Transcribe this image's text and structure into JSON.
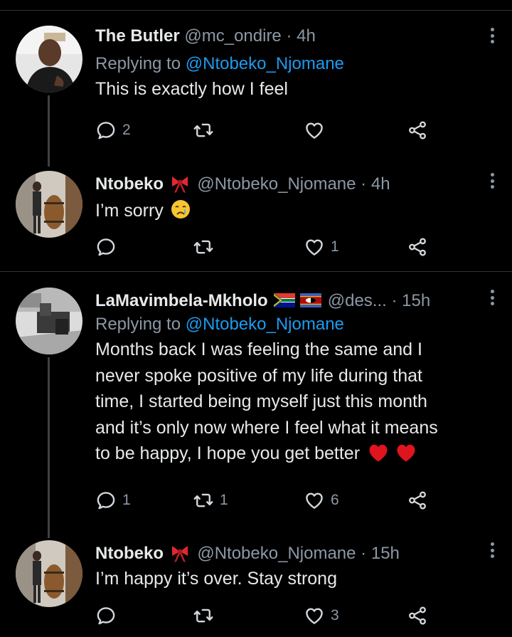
{
  "colors": {
    "background": "#000000",
    "text": "#e7e9ea",
    "muted": "#8b98a5",
    "link": "#1d9bf0",
    "separator": "#2f3336"
  },
  "icons": {
    "reply": "reply-icon",
    "retweet": "retweet-icon",
    "like": "heart-icon",
    "share": "share-icon",
    "more": "more-icon"
  },
  "tweets": [
    {
      "name": "The Butler",
      "handle": "@mc_ondire",
      "separator": "·",
      "time": "4h",
      "replying_prefix": "Replying to",
      "replying_to": "@Ntobeko_Njomane",
      "text": "This is exactly how I feel",
      "replies": "2",
      "retweets": "",
      "likes": ""
    },
    {
      "name": "Ntobeko",
      "name_emoji": "ribbon-emoji",
      "handle": "@Ntobeko_Njomane",
      "separator": "·",
      "time": "4h",
      "text": "I’m sorry",
      "text_emoji": "crying-face-emoji",
      "replies": "",
      "retweets": "",
      "likes": "1"
    },
    {
      "name": "LaMavimbela-Mkholo",
      "name_emoji": "flags-south-africa-eswatini",
      "handle": "@des...",
      "separator": "·",
      "time": "15h",
      "replying_prefix": "Replying to",
      "replying_to": "@Ntobeko_Njomane",
      "text_lines": [
        "Months back I was feeling the same and I",
        "never spoke positive of my life during that",
        "time, I started being myself just this month",
        "and it’s only now where I feel what it means",
        "to be happy, I hope you get better"
      ],
      "text_emoji": "red-heart-emoji-x2",
      "replies": "1",
      "retweets": "1",
      "likes": "6"
    },
    {
      "name": "Ntobeko",
      "name_emoji": "ribbon-emoji",
      "handle": "@Ntobeko_Njomane",
      "separator": "·",
      "time": "15h",
      "text": "I’m happy it’s over. Stay strong",
      "replies": "",
      "retweets": "",
      "likes": "3"
    }
  ]
}
